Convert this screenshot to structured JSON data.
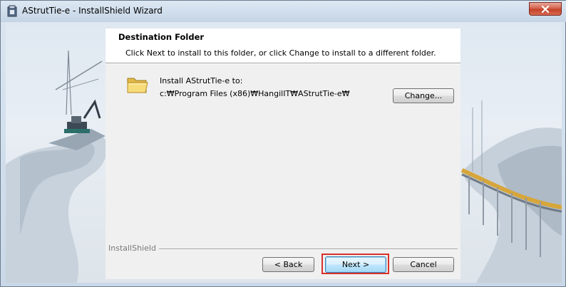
{
  "window": {
    "title": "AStrutTie-e - InstallShield Wizard",
    "icons": {
      "app": "installer-app-icon",
      "close": "close-icon"
    },
    "close_color": "#c4422a"
  },
  "header": {
    "title": "Destination Folder",
    "subtitle": "Click Next to install to this folder, or click Change to install to a different folder."
  },
  "body": {
    "install_label": "Install AStrutTie-e to:",
    "install_path": "c:₩Program Files (x86)₩HangilIT₩AStrutTie-e₩",
    "folder_icon": "folder-icon",
    "change_label": "Change..."
  },
  "footer": {
    "brand": "InstallShield",
    "back_label": "< Back",
    "next_label": "Next >",
    "cancel_label": "Cancel",
    "highlight_color": "#d9302a"
  }
}
